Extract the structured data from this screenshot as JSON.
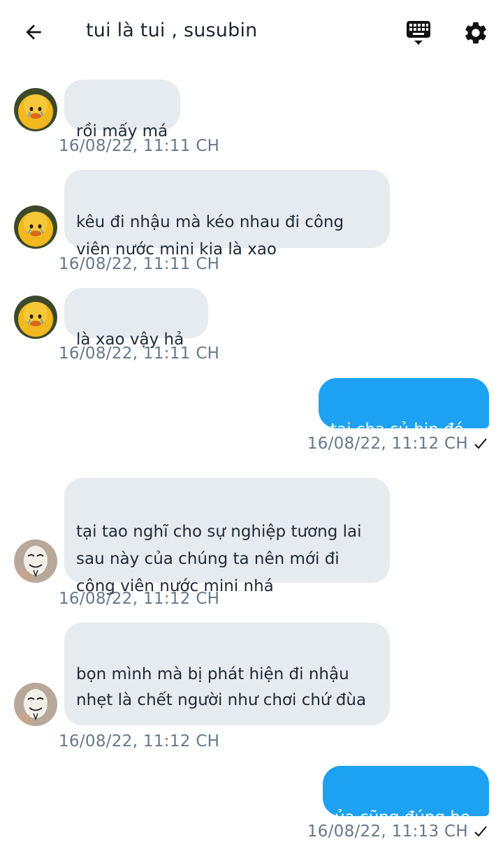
{
  "header": {
    "title": "tui là tui ,  susubin",
    "back_icon": "arrow-left-icon",
    "keyboard_icon": "keyboard-icon",
    "settings_icon": "gear-icon"
  },
  "colors": {
    "outgoing_bubble": "#1da1f2",
    "incoming_bubble": "#e6ebf0",
    "timestamp": "#66788a"
  },
  "messages": [
    {
      "direction": "in",
      "text": "rồi mấy má",
      "time": "16/08/22,  11:11 CH",
      "avatar": "duck-avatar"
    },
    {
      "direction": "in",
      "text": "kêu đi nhậu mà kéo nhau đi công viên nước mini kia là xao",
      "time": "16/08/22,  11:11 CH",
      "avatar": "duck-avatar"
    },
    {
      "direction": "in",
      "text": "là xao vậy hả",
      "time": "16/08/22,  11:11 CH",
      "avatar": "duck-avatar"
    },
    {
      "direction": "out",
      "text": "tại cha sủ bin đó",
      "time": "16/08/22,  11:12 CH",
      "status_icon": "checkmark-icon"
    },
    {
      "direction": "in",
      "text": "tại tao nghĩ cho sự nghiệp tương lai sau này của chúng ta nên mới đi công viên nước mini nhá",
      "time": "16/08/22,  11:12 CH",
      "avatar": "mask-avatar"
    },
    {
      "direction": "in",
      "text": "bọn mình mà bị phát hiện đi nhậu nhẹt là chết người như chơi chứ đùa",
      "time": "16/08/22,  11:12 CH",
      "avatar": "mask-avatar"
    },
    {
      "direction": "out",
      "text": "ủa cũng đúng he",
      "time": "16/08/22,  11:13 CH",
      "status_icon": "checkmark-icon"
    }
  ]
}
